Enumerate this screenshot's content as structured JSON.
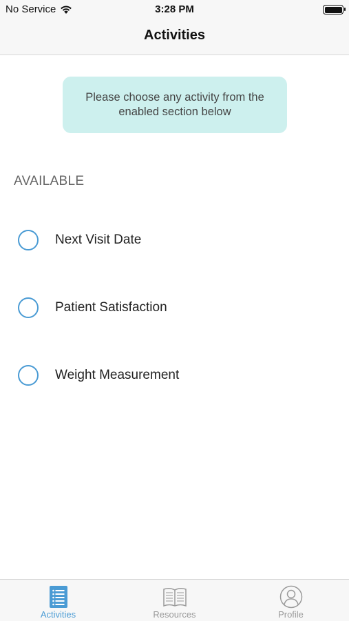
{
  "status_bar": {
    "carrier": "No Service",
    "time": "3:28 PM"
  },
  "nav": {
    "title": "Activities"
  },
  "banner": {
    "text": "Please choose any activity from the enabled section below"
  },
  "section": {
    "header": "AVAILABLE"
  },
  "activities": [
    {
      "label": "Next Visit Date",
      "selected": false
    },
    {
      "label": "Patient Satisfaction",
      "selected": false
    },
    {
      "label": "Weight Measurement",
      "selected": false
    }
  ],
  "tab_bar": {
    "tabs": [
      {
        "label": "Activities",
        "icon": "list-icon",
        "active": true
      },
      {
        "label": "Resources",
        "icon": "book-icon",
        "active": false
      },
      {
        "label": "Profile",
        "icon": "profile-icon",
        "active": false
      }
    ]
  },
  "colors": {
    "accent": "#4a9bd4",
    "banner_bg": "#cdf0ee",
    "inactive_tab": "#9a9a9a"
  }
}
